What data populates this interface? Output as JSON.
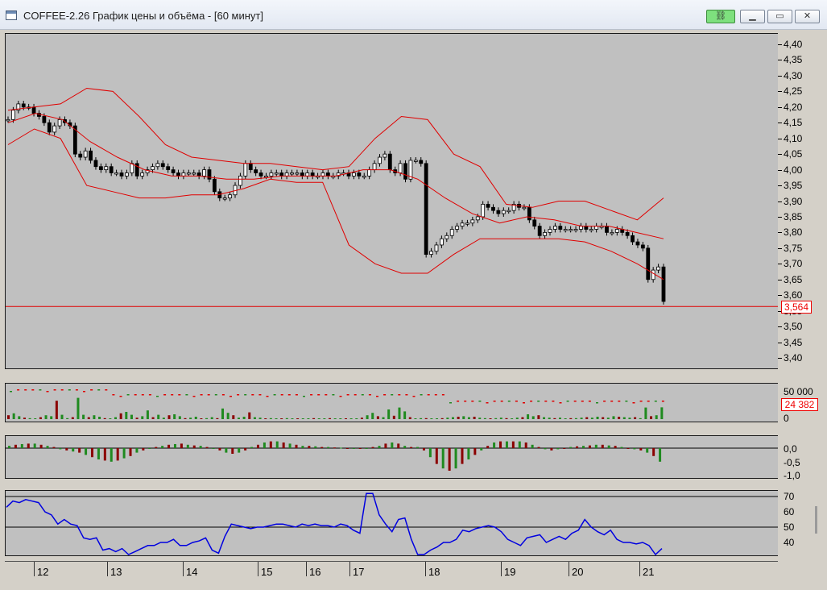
{
  "window": {
    "title": "COFFEE-2.26 График цены и объёма - [60 минут]",
    "icons": {
      "app": "chart-window-icon",
      "link": "link-icon",
      "minimize": "minimize-icon",
      "restore": "restore-icon",
      "close": "close-icon"
    }
  },
  "price_axis": {
    "labels": [
      "4,40",
      "4,35",
      "4,30",
      "4,25",
      "4,20",
      "4,15",
      "4,10",
      "4,05",
      "4,00",
      "3,95",
      "3,90",
      "3,85",
      "3,80",
      "3,75",
      "3,70",
      "3,65",
      "3,60",
      "3,55",
      "3,50",
      "3,45",
      "3,40"
    ],
    "current_price": "3,564"
  },
  "volume_axis": {
    "labels": [
      "50 000",
      "0"
    ],
    "current_volume": "24 382"
  },
  "oscillator_axis": {
    "labels": [
      "0,0",
      "-0,5",
      "-1,0"
    ]
  },
  "rsi_axis": {
    "labels": [
      "70",
      "60",
      "50",
      "40"
    ]
  },
  "time_axis": {
    "labels": [
      "12",
      "13",
      "14",
      "15",
      "16",
      "17",
      "18",
      "19",
      "20",
      "21"
    ]
  },
  "colors": {
    "background": "#c0c0c0",
    "bollinger": "#e00000",
    "bull": "#1f8a1f",
    "bear": "#8b0000",
    "rsi": "#0000e0",
    "price_line": "#e00000"
  },
  "chart_data": [
    {
      "type": "candlestick",
      "title": "",
      "ylim": [
        3.37,
        4.45
      ],
      "current_price_line": 3.564,
      "close_approx": [
        4.16,
        4.19,
        4.21,
        4.2,
        4.2,
        4.18,
        4.17,
        4.15,
        4.12,
        4.14,
        4.16,
        4.15,
        4.14,
        4.05,
        4.04,
        4.06,
        4.03,
        4.01,
        4.0,
        4.01,
        3.99,
        3.99,
        3.98,
        3.99,
        4.02,
        3.98,
        3.99,
        4.0,
        4.01,
        4.02,
        4.01,
        4.0,
        3.99,
        3.98,
        3.99,
        3.99,
        3.99,
        3.98,
        4.0,
        3.97,
        3.93,
        3.91,
        3.91,
        3.92,
        3.95,
        3.98,
        4.02,
        4.0,
        3.99,
        3.98,
        3.98,
        3.99,
        3.99,
        3.98,
        3.99,
        3.99,
        3.99,
        3.98,
        3.99,
        3.98,
        3.98,
        3.99,
        3.98,
        3.98,
        3.99,
        3.99,
        3.98,
        3.99,
        3.98,
        3.98,
        4.0,
        4.02,
        4.04,
        4.05,
        4.0,
        3.99,
        4.02,
        3.97,
        4.03,
        4.03,
        4.02,
        3.73,
        3.74,
        3.76,
        3.78,
        3.79,
        3.81,
        3.82,
        3.83,
        3.83,
        3.84,
        3.85,
        3.89,
        3.88,
        3.87,
        3.86,
        3.87,
        3.87,
        3.89,
        3.88,
        3.88,
        3.84,
        3.82,
        3.79,
        3.8,
        3.81,
        3.82,
        3.81,
        3.81,
        3.81,
        3.81,
        3.82,
        3.81,
        3.81,
        3.82,
        3.82,
        3.8,
        3.8,
        3.81,
        3.8,
        3.79,
        3.77,
        3.76,
        3.75,
        3.65,
        3.68,
        3.69,
        3.58
      ],
      "bollinger": {
        "upper_approx": [
          4.19,
          4.2,
          4.21,
          4.26,
          4.25,
          4.17,
          4.08,
          4.04,
          4.03,
          4.02,
          4.02,
          4.01,
          4.0,
          4.01,
          4.1,
          4.17,
          4.16,
          4.05,
          4.01,
          3.89,
          3.88,
          3.9,
          3.9,
          3.87,
          3.84,
          3.91
        ],
        "middle_approx": [
          4.15,
          4.18,
          4.16,
          4.09,
          4.04,
          4.0,
          3.98,
          3.98,
          3.97,
          3.97,
          3.98,
          3.98,
          3.98,
          4.0,
          4.0,
          3.97,
          3.91,
          3.86,
          3.83,
          3.85,
          3.84,
          3.82,
          3.82,
          3.8,
          3.78
        ],
        "lower_approx": [
          4.08,
          4.13,
          4.1,
          3.95,
          3.93,
          3.91,
          3.91,
          3.92,
          3.92,
          3.94,
          3.97,
          3.96,
          3.96,
          3.76,
          3.7,
          3.67,
          3.67,
          3.73,
          3.78,
          3.78,
          3.78,
          3.78,
          3.77,
          3.74,
          3.7,
          3.65
        ]
      }
    },
    {
      "type": "bar",
      "title": "volume",
      "ylim": [
        0,
        60000
      ],
      "last_value": 24382,
      "values_approx": [
        8000,
        12000,
        6000,
        3000,
        2000,
        1000,
        4000,
        8000,
        6000,
        38000,
        9000,
        2000,
        4000,
        44000,
        9000,
        4000,
        8000,
        5000,
        2000,
        1000,
        4000,
        12000,
        15000,
        9000,
        3000,
        6000,
        18000,
        4000,
        9000,
        3000,
        8000,
        10000,
        6000,
        2000,
        3000,
        5000,
        1000,
        2000,
        4000,
        2000,
        22000,
        13000,
        8000,
        3000,
        5000,
        14000,
        4000,
        3000,
        1000,
        2000,
        1000,
        1000,
        2000,
        1000,
        1000,
        1000,
        1000,
        2000,
        1000,
        1000,
        2000,
        1000,
        1000,
        1000,
        1000,
        1000,
        3000,
        8000,
        13000,
        6000,
        4000,
        20000,
        7000,
        24000,
        16000,
        4000,
        1000,
        2000,
        2000,
        1000,
        1000,
        2000,
        3000,
        4000,
        5000,
        6000,
        4000,
        5000,
        3000,
        2000,
        1000,
        2000,
        3000,
        2000,
        1000,
        3000,
        4000,
        10000,
        6000,
        8000,
        4000,
        3000,
        2000,
        3000,
        1000,
        2000,
        2000,
        3000,
        4000,
        3000,
        5000,
        4000,
        3000,
        6000,
        5000,
        4000,
        3000,
        4000,
        2000,
        24000,
        6000,
        8000,
        24382
      ],
      "colors_approx": "mixed bull/bear"
    },
    {
      "type": "bar",
      "title": "oscillator",
      "ylim": [
        -1.2,
        0.45
      ],
      "values_approx": [
        0.1,
        0.15,
        0.18,
        0.2,
        0.2,
        0.15,
        0.1,
        0.05,
        -0.05,
        -0.1,
        -0.15,
        -0.2,
        -0.3,
        -0.4,
        -0.5,
        -0.55,
        -0.6,
        -0.55,
        -0.45,
        -0.35,
        -0.2,
        -0.1,
        0.0,
        0.05,
        0.1,
        0.15,
        0.18,
        0.2,
        0.15,
        0.12,
        0.1,
        0.05,
        0.0,
        -0.1,
        -0.2,
        -0.25,
        -0.2,
        -0.1,
        0.05,
        0.15,
        0.25,
        0.3,
        0.3,
        0.25,
        0.2,
        0.15,
        0.1,
        0.1,
        0.08,
        0.05,
        0.05,
        0.03,
        0.02,
        0.0,
        -0.02,
        0.0,
        0.0,
        0.05,
        0.1,
        0.2,
        0.25,
        0.2,
        0.1,
        0.05,
        0.05,
        -0.1,
        -0.4,
        -0.7,
        -0.9,
        -1.0,
        -0.9,
        -0.7,
        -0.5,
        -0.3,
        -0.1,
        0.1,
        0.25,
        0.3,
        0.3,
        0.3,
        0.3,
        0.25,
        0.15,
        0.05,
        -0.05,
        -0.1,
        -0.05,
        0.0,
        0.05,
        0.08,
        0.1,
        0.12,
        0.15,
        0.15,
        0.12,
        0.1,
        0.05,
        0.0,
        -0.05,
        -0.1,
        -0.2,
        -0.35,
        -0.6
      ]
    },
    {
      "type": "line",
      "title": "",
      "ylim": [
        32,
        72
      ],
      "values_approx": [
        63,
        67,
        66,
        68,
        67,
        66,
        60,
        58,
        52,
        55,
        52,
        51,
        43,
        42,
        43,
        35,
        36,
        34,
        36,
        32,
        34,
        36,
        38,
        38,
        40,
        40,
        42,
        38,
        38,
        40,
        41,
        43,
        35,
        33,
        44,
        52,
        51,
        50,
        49,
        50,
        50,
        51,
        52,
        52,
        51,
        50,
        52,
        51,
        52,
        51,
        51,
        50,
        52,
        51,
        48,
        46,
        72,
        72,
        58,
        52,
        47,
        55,
        56,
        42,
        30,
        32,
        35,
        37,
        40,
        40,
        42,
        48,
        47,
        49,
        50,
        51,
        50,
        47,
        42,
        40,
        38,
        43,
        44,
        45,
        40,
        42,
        44,
        42,
        46,
        48,
        55,
        50,
        47,
        45,
        48,
        42,
        40,
        40,
        39,
        40,
        38,
        32,
        36
      ]
    }
  ]
}
